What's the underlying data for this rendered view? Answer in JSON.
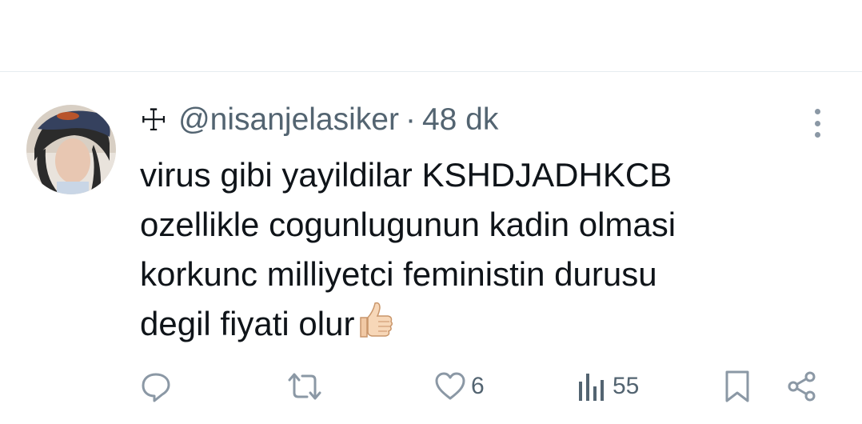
{
  "tweet": {
    "author_glyph": "☩",
    "handle": "@nisanjelasiker",
    "separator": "·",
    "time": "48 dk",
    "lines": [
      "virus gibi yayildilar KSHDJADHKCB",
      "ozellikle cogunlugunun kadin olmasi",
      "korkunc milliyetci feministin durusu",
      "degil fiyati olur"
    ],
    "emoji": "thumbs-up"
  },
  "actions": {
    "reply_icon": "reply-icon",
    "retweet_icon": "retweet-icon",
    "like_icon": "heart-icon",
    "like_count": "6",
    "views_icon": "views-icon",
    "views_count": "55",
    "bookmark_icon": "bookmark-icon",
    "share_icon": "share-icon"
  },
  "colors": {
    "text": "#0f1419",
    "secondary": "#536471",
    "divider": "#e6ecf0"
  }
}
